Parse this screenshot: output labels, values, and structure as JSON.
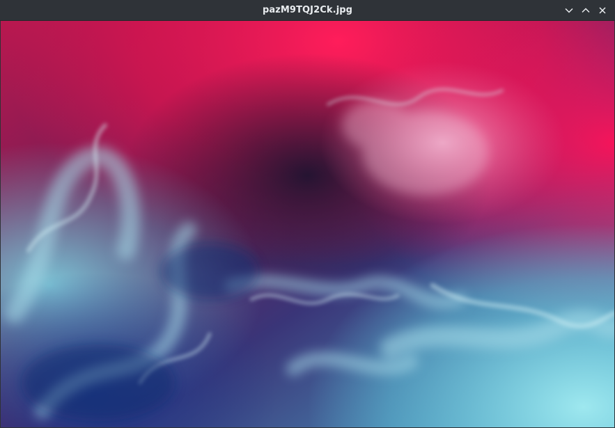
{
  "window": {
    "title": "pazM9TQJ2Ck.jpg"
  },
  "controls": {
    "minimize_icon": "chevron-down-icon",
    "maximize_icon": "chevron-up-icon",
    "close_icon": "close-icon"
  },
  "image": {
    "description_colors": {
      "magenta": "#e0134f",
      "pink": "#e86a9a",
      "deep_purple": "#2a1a3e",
      "indigo": "#3b4a8c",
      "teal": "#5fc3d8",
      "cyan": "#8ee0e8"
    }
  }
}
